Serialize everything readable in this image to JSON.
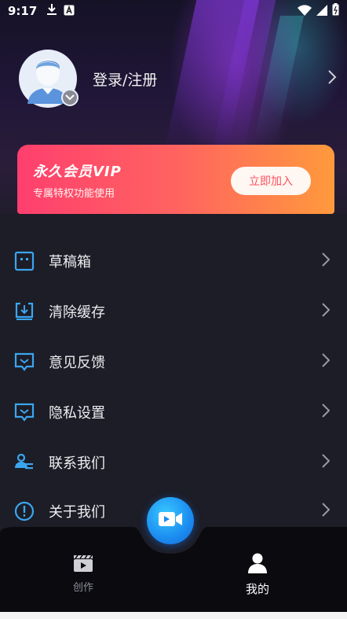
{
  "status_bar": {
    "time": "9:17"
  },
  "profile": {
    "login_label": "登录/注册"
  },
  "vip": {
    "title": "永久会员VIP",
    "subtitle": "专属特权功能使用",
    "join_label": "立即加入"
  },
  "menu": [
    {
      "label": "草稿箱",
      "icon": "drafts-icon"
    },
    {
      "label": "清除缓存",
      "icon": "clear-cache-icon"
    },
    {
      "label": "意见反馈",
      "icon": "feedback-icon"
    },
    {
      "label": "隐私设置",
      "icon": "privacy-icon"
    },
    {
      "label": "联系我们",
      "icon": "contact-icon"
    },
    {
      "label": "关于我们",
      "icon": "info-icon"
    }
  ],
  "bottom_nav": {
    "create_label": "创作",
    "mine_label": "我的"
  },
  "colors": {
    "accent": "#1b8cf0",
    "vip_start": "#ff3f6e",
    "vip_end": "#ff9a3c",
    "menu_icon": "#3aa6f0",
    "background": "#1d1d27"
  }
}
